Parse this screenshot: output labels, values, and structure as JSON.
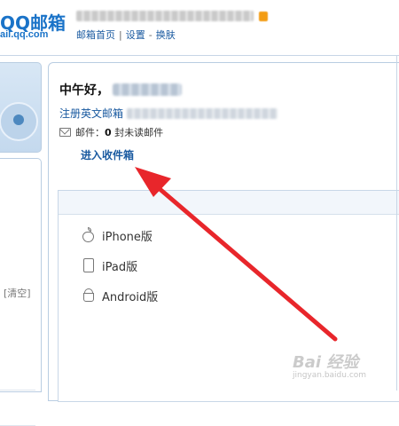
{
  "brand": {
    "logo_text": "QQ邮箱",
    "logo_sub": "ail.qq.com"
  },
  "header": {
    "links": [
      "邮箱首页",
      "设置",
      "换肤"
    ],
    "separator": "|",
    "dash": "-"
  },
  "sidebar": {
    "clear_label": "[清空]"
  },
  "welcome": {
    "greeting": "中午好，",
    "register_label": "注册英文邮箱",
    "mail_label": "邮件：",
    "unread_count": "0",
    "unread_suffix": "封未读邮件",
    "inbox_link": "进入收件箱"
  },
  "apps": [
    {
      "icon": "apple-icon",
      "label": "iPhone版"
    },
    {
      "icon": "ipad-icon",
      "label": "iPad版"
    },
    {
      "icon": "android-icon",
      "label": "Android版"
    }
  ],
  "annotation": {
    "arrow_color": "#e8262b"
  },
  "watermark": {
    "text": "Bai 经验",
    "sub": "jingyan.baidu.com"
  },
  "colors": {
    "brand_blue": "#1a73c8",
    "link_blue": "#1a5aa0"
  }
}
